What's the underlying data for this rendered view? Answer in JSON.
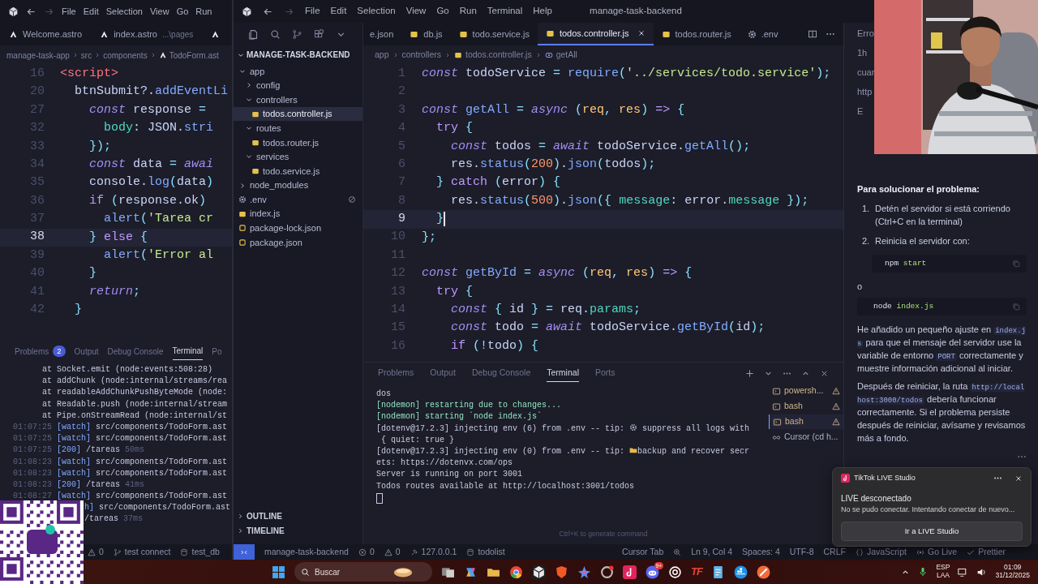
{
  "left_window": {
    "menu": [
      "File",
      "Edit",
      "Selection",
      "View",
      "Go",
      "Run"
    ],
    "tabs": [
      {
        "label": "Welcome.astro",
        "selected": false
      },
      {
        "label": "index.astro",
        "detail": "...\\pages",
        "selected": false
      }
    ],
    "breadcrumb": [
      "manage-task-app",
      "src",
      "components",
      "TodoForm.ast"
    ],
    "code": [
      {
        "n": "16",
        "current": false,
        "tokens": [
          {
            "text": "<script>",
            "kind": "tag"
          }
        ]
      },
      {
        "n": "20",
        "current": false,
        "tokens": [
          {
            "text": "  btnSubmit?.",
            "kind": "variable"
          },
          {
            "text": "addEventLi",
            "kind": "function"
          }
        ]
      },
      {
        "n": "27",
        "current": false,
        "tokens": [
          {
            "text": "    const ",
            "kind": "keyword"
          },
          {
            "text": "response ",
            "kind": "variable"
          },
          {
            "text": "=",
            "kind": "operator"
          }
        ]
      },
      {
        "n": "32",
        "current": false,
        "tokens": [
          {
            "text": "      body",
            "kind": "property"
          },
          {
            "text": ": JSON.",
            "kind": "variable"
          },
          {
            "text": "stri",
            "kind": "function"
          }
        ]
      },
      {
        "n": "33",
        "current": false,
        "tokens": [
          {
            "text": "    })",
            "kind": "punct"
          },
          {
            "text": ";",
            "kind": "operator"
          }
        ]
      },
      {
        "n": "34",
        "current": false,
        "tokens": [
          {
            "text": "    const ",
            "kind": "keyword"
          },
          {
            "text": "data ",
            "kind": "variable"
          },
          {
            "text": "= ",
            "kind": "operator"
          },
          {
            "text": "awai",
            "kind": "keyword"
          }
        ]
      },
      {
        "n": "35",
        "current": false,
        "tokens": [
          {
            "text": "    console.",
            "kind": "variable"
          },
          {
            "text": "log",
            "kind": "function"
          },
          {
            "text": "(",
            "kind": "punct"
          },
          {
            "text": "data",
            "kind": "variable"
          },
          {
            "text": ")",
            "kind": "punct"
          }
        ]
      },
      {
        "n": "36",
        "current": false,
        "tokens": [
          {
            "text": "    if ",
            "kind": "control"
          },
          {
            "text": "(",
            "kind": "punct"
          },
          {
            "text": "response.ok",
            "kind": "variable"
          },
          {
            "text": ")",
            "kind": "punct"
          }
        ]
      },
      {
        "n": "37",
        "current": false,
        "tokens": [
          {
            "text": "      alert",
            "kind": "function"
          },
          {
            "text": "(",
            "kind": "punct"
          },
          {
            "text": "'Tarea cr",
            "kind": "string"
          }
        ]
      },
      {
        "n": "38",
        "current": true,
        "tokens": [
          {
            "text": "    } ",
            "kind": "punct"
          },
          {
            "text": "else ",
            "kind": "control"
          },
          {
            "text": "{",
            "kind": "punct"
          }
        ]
      },
      {
        "n": "39",
        "current": false,
        "tokens": [
          {
            "text": "      alert",
            "kind": "function"
          },
          {
            "text": "(",
            "kind": "punct"
          },
          {
            "text": "'Error al",
            "kind": "string"
          }
        ]
      },
      {
        "n": "40",
        "current": false,
        "tokens": [
          {
            "text": "    }",
            "kind": "punct"
          }
        ]
      },
      {
        "n": "41",
        "current": false,
        "tokens": [
          {
            "text": "    return",
            "kind": "keyword"
          },
          {
            "text": ";",
            "kind": "operator"
          }
        ]
      },
      {
        "n": "42",
        "current": false,
        "tokens": [
          {
            "text": "  }",
            "kind": "punct"
          }
        ]
      }
    ],
    "panel_tabs": [
      {
        "label": "Problems",
        "badge": "2",
        "selected": false
      },
      {
        "label": "Output",
        "selected": false
      },
      {
        "label": "Debug Console",
        "selected": false
      },
      {
        "label": "Terminal",
        "selected": true
      },
      {
        "label": "Po",
        "selected": false
      }
    ],
    "terminal": [
      {
        "kind": "line",
        "text": "      at Socket.emit (node:events:508:28)"
      },
      {
        "kind": "line",
        "text": "      at addChunk (node:internal/streams/rea"
      },
      {
        "kind": "line",
        "text": "      at readableAddChunkPushByteMode (node:"
      },
      {
        "kind": "line",
        "text": "      at Readable.push (node:internal/stream"
      },
      {
        "kind": "line",
        "text": "      at Pipe.onStreamRead (node:internal/st"
      },
      {
        "kind": "line",
        "time": "01:07:25 ",
        "tag": "[watch]",
        "text": " src/components/TodoForm.ast"
      },
      {
        "kind": "line",
        "time": "01:07:25 ",
        "tag": "[watch]",
        "text": " src/components/TodoForm.ast"
      },
      {
        "kind": "line",
        "time": "01:07:25 ",
        "tag": "[200]",
        "text": " /tareas ",
        "ms": "50ms"
      },
      {
        "kind": "line",
        "time": "01:08:23 ",
        "tag": "[watch]",
        "text": " src/components/TodoForm.ast"
      },
      {
        "kind": "line",
        "time": "01:08:23 ",
        "tag": "[watch]",
        "text": " src/components/TodoForm.ast"
      },
      {
        "kind": "line",
        "time": "01:08:23 ",
        "tag": "[200]",
        "text": " /tareas ",
        "ms": "41ms"
      },
      {
        "kind": "line",
        "time": "01:08:27 ",
        "tag": "[watch]",
        "text": " src/components/TodoForm.ast"
      },
      {
        "kind": "clipped",
        "tag": "h]",
        "text": " src/components/TodoForm.ast"
      },
      {
        "kind": "clipped",
        "text": "/tareas ",
        "ms": "37ms"
      }
    ],
    "status": [
      {
        "kind": "warning",
        "text": "0"
      },
      {
        "kind": "branch",
        "text": "test connect"
      },
      {
        "kind": "db",
        "text": "test_db"
      }
    ]
  },
  "main_window": {
    "menu": [
      "File",
      "Edit",
      "Selection",
      "View",
      "Go",
      "Run",
      "Terminal",
      "Help"
    ],
    "title": "manage-task-backend",
    "explorer": {
      "title": "MANAGE-TASK-BACKEND",
      "tree": [
        {
          "label": "app",
          "kind": "folder",
          "expanded": true,
          "selected": false,
          "ignored": false,
          "children": [
            {
              "label": "config",
              "kind": "folder",
              "expanded": false,
              "selected": false
            },
            {
              "label": "controllers",
              "kind": "folder",
              "expanded": true,
              "selected": false,
              "children": [
                {
                  "label": "todos.controller.js",
                  "kind": "js",
                  "selected": true
                }
              ]
            },
            {
              "label": "routes",
              "kind": "folder",
              "expanded": true,
              "selected": false,
              "children": [
                {
                  "label": "todos.router.js",
                  "kind": "js",
                  "selected": false
                }
              ]
            },
            {
              "label": "services",
              "kind": "folder",
              "expanded": true,
              "selected": false,
              "children": [
                {
                  "label": "todo.service.js",
                  "kind": "js",
                  "selected": false
                }
              ]
            }
          ]
        },
        {
          "label": "node_modules",
          "kind": "folder",
          "expanded": false,
          "selected": false,
          "ignored": false
        },
        {
          "label": ".env",
          "kind": "env",
          "selected": false,
          "ignored": true
        },
        {
          "label": "index.js",
          "kind": "js",
          "selected": false,
          "ignored": false
        },
        {
          "label": "package-lock.json",
          "kind": "json",
          "selected": false,
          "ignored": false
        },
        {
          "label": "package.json",
          "kind": "json",
          "selected": false,
          "ignored": false
        }
      ],
      "outline": "OUTLINE",
      "timeline": "TIMELINE"
    },
    "tabs": [
      {
        "label": "e.json",
        "kind": "hidden",
        "selected": false
      },
      {
        "label": "db.js",
        "kind": "js",
        "selected": false
      },
      {
        "label": "todo.service.js",
        "kind": "js",
        "selected": false
      },
      {
        "label": "todos.controller.js",
        "kind": "js",
        "selected": true
      },
      {
        "label": "todos.router.js",
        "kind": "js",
        "selected": false
      },
      {
        "label": ".env",
        "kind": "env",
        "selected": false
      }
    ],
    "breadcrumb": [
      {
        "text": "app",
        "kind": "folder"
      },
      {
        "text": "controllers",
        "kind": "folder"
      },
      {
        "text": "todos.controller.js",
        "kind": "js"
      },
      {
        "text": "getAll",
        "kind": "symbol"
      }
    ],
    "code": [
      {
        "n": "1",
        "current": false,
        "tokens": [
          {
            "text": "const ",
            "kind": "keyword"
          },
          {
            "text": "todoService ",
            "kind": "variable"
          },
          {
            "text": "= ",
            "kind": "operator"
          },
          {
            "text": "require",
            "kind": "function"
          },
          {
            "text": "(",
            "kind": "punct"
          },
          {
            "text": "'../services/todo.service'",
            "kind": "string"
          },
          {
            "text": ")",
            "kind": "punct"
          },
          {
            "text": ";",
            "kind": "operator"
          }
        ]
      },
      {
        "n": "2",
        "current": false
      },
      {
        "n": "3",
        "current": false,
        "tokens": [
          {
            "text": "const ",
            "kind": "keyword"
          },
          {
            "text": "getAll ",
            "kind": "function"
          },
          {
            "text": "= ",
            "kind": "operator"
          },
          {
            "text": "async ",
            "kind": "keyword"
          },
          {
            "text": "(",
            "kind": "punct"
          },
          {
            "text": "req",
            "kind": "param"
          },
          {
            "text": ", ",
            "kind": "operator"
          },
          {
            "text": "res",
            "kind": "param"
          },
          {
            "text": ") ",
            "kind": "punct"
          },
          {
            "text": "=> ",
            "kind": "control"
          },
          {
            "text": "{",
            "kind": "punct"
          }
        ]
      },
      {
        "n": "4",
        "current": false,
        "tokens": [
          {
            "text": "  try ",
            "kind": "control"
          },
          {
            "text": "{",
            "kind": "punct"
          }
        ]
      },
      {
        "n": "5",
        "current": false,
        "tokens": [
          {
            "text": "    const ",
            "kind": "keyword"
          },
          {
            "text": "todos ",
            "kind": "variable"
          },
          {
            "text": "= ",
            "kind": "operator"
          },
          {
            "text": "await ",
            "kind": "keyword"
          },
          {
            "text": "todoService.",
            "kind": "variable"
          },
          {
            "text": "getAll",
            "kind": "function"
          },
          {
            "text": "()",
            "kind": "punct"
          },
          {
            "text": ";",
            "kind": "operator"
          }
        ]
      },
      {
        "n": "6",
        "current": false,
        "tokens": [
          {
            "text": "    res.",
            "kind": "variable"
          },
          {
            "text": "status",
            "kind": "function"
          },
          {
            "text": "(",
            "kind": "punct"
          },
          {
            "text": "200",
            "kind": "number"
          },
          {
            "text": ")",
            "kind": "punct"
          },
          {
            "text": ".",
            "kind": "variable"
          },
          {
            "text": "json",
            "kind": "function"
          },
          {
            "text": "(",
            "kind": "punct"
          },
          {
            "text": "todos",
            "kind": "variable"
          },
          {
            "text": ")",
            "kind": "punct"
          },
          {
            "text": ";",
            "kind": "operator"
          }
        ]
      },
      {
        "n": "7",
        "current": false,
        "tokens": [
          {
            "text": "  } ",
            "kind": "punct"
          },
          {
            "text": "catch ",
            "kind": "control"
          },
          {
            "text": "(",
            "kind": "punct"
          },
          {
            "text": "error",
            "kind": "variable"
          },
          {
            "text": ") {",
            "kind": "punct"
          }
        ]
      },
      {
        "n": "8",
        "current": false,
        "tokens": [
          {
            "text": "    res.",
            "kind": "variable"
          },
          {
            "text": "status",
            "kind": "function"
          },
          {
            "text": "(",
            "kind": "punct"
          },
          {
            "text": "500",
            "kind": "number"
          },
          {
            "text": ")",
            "kind": "punct"
          },
          {
            "text": ".",
            "kind": "variable"
          },
          {
            "text": "json",
            "kind": "function"
          },
          {
            "text": "({ ",
            "kind": "punct"
          },
          {
            "text": "message",
            "kind": "property"
          },
          {
            "text": ": error.",
            "kind": "variable"
          },
          {
            "text": "message",
            "kind": "property"
          },
          {
            "text": " })",
            "kind": "punct"
          },
          {
            "text": ";",
            "kind": "operator"
          }
        ]
      },
      {
        "n": "9",
        "current": true,
        "tokens": [
          {
            "text": "  }",
            "kind": "punct"
          }
        ]
      },
      {
        "n": "10",
        "current": false,
        "tokens": [
          {
            "text": "}",
            "kind": "punct"
          },
          {
            "text": ";",
            "kind": "operator"
          }
        ]
      },
      {
        "n": "11",
        "current": false
      },
      {
        "n": "12",
        "current": false,
        "tokens": [
          {
            "text": "const ",
            "kind": "keyword"
          },
          {
            "text": "getById ",
            "kind": "function"
          },
          {
            "text": "= ",
            "kind": "operator"
          },
          {
            "text": "async ",
            "kind": "keyword"
          },
          {
            "text": "(",
            "kind": "punct"
          },
          {
            "text": "req",
            "kind": "param"
          },
          {
            "text": ", ",
            "kind": "operator"
          },
          {
            "text": "res",
            "kind": "param"
          },
          {
            "text": ") ",
            "kind": "punct"
          },
          {
            "text": "=> ",
            "kind": "control"
          },
          {
            "text": "{",
            "kind": "punct"
          }
        ]
      },
      {
        "n": "13",
        "current": false,
        "tokens": [
          {
            "text": "  try ",
            "kind": "control"
          },
          {
            "text": "{",
            "kind": "punct"
          }
        ]
      },
      {
        "n": "14",
        "current": false,
        "tokens": [
          {
            "text": "    const ",
            "kind": "keyword"
          },
          {
            "text": "{ ",
            "kind": "punct"
          },
          {
            "text": "id ",
            "kind": "variable"
          },
          {
            "text": "} ",
            "kind": "punct"
          },
          {
            "text": "= ",
            "kind": "operator"
          },
          {
            "text": "req.",
            "kind": "variable"
          },
          {
            "text": "params",
            "kind": "property"
          },
          {
            "text": ";",
            "kind": "operator"
          }
        ]
      },
      {
        "n": "15",
        "current": false,
        "tokens": [
          {
            "text": "    const ",
            "kind": "keyword"
          },
          {
            "text": "todo ",
            "kind": "variable"
          },
          {
            "text": "= ",
            "kind": "operator"
          },
          {
            "text": "await ",
            "kind": "keyword"
          },
          {
            "text": "todoService.",
            "kind": "variable"
          },
          {
            "text": "getById",
            "kind": "function"
          },
          {
            "text": "(",
            "kind": "punct"
          },
          {
            "text": "id",
            "kind": "variable"
          },
          {
            "text": ")",
            "kind": "punct"
          },
          {
            "text": ";",
            "kind": "operator"
          }
        ]
      },
      {
        "n": "16",
        "current": false,
        "tokens": [
          {
            "text": "    if ",
            "kind": "control"
          },
          {
            "text": "(",
            "kind": "punct"
          },
          {
            "text": "!",
            "kind": "operator"
          },
          {
            "text": "todo",
            "kind": "variable"
          },
          {
            "text": ") {",
            "kind": "punct"
          }
        ]
      }
    ],
    "panel_tabs": [
      {
        "label": "Problems",
        "selected": false
      },
      {
        "label": "Output",
        "selected": false
      },
      {
        "label": "Debug Console",
        "selected": false
      },
      {
        "label": "Terminal",
        "selected": true
      },
      {
        "label": "Ports",
        "selected": false
      }
    ],
    "terminal": [
      {
        "kind": "output",
        "text": "dos"
      },
      {
        "kind": "nodemon",
        "text": "[nodemon] restarting due to changes..."
      },
      {
        "kind": "nodemon",
        "text": "[nodemon] starting `node index.js`"
      },
      {
        "kind": "gear-tip",
        "text": "[dotenv@17.2.3] injecting env (6) from .env -- tip: ",
        "rest": "suppress all logs with"
      },
      {
        "kind": "output",
        "text": " { quiet: true }"
      },
      {
        "kind": "folder-tip",
        "text": "[dotenv@17.2.3] injecting env (0) from .env -- tip: ",
        "rest": "backup and recover secr"
      },
      {
        "kind": "output",
        "text": "ets: https://dotenvx.com/ops"
      },
      {
        "kind": "output",
        "text": "Server is running on port 3001"
      },
      {
        "kind": "output",
        "text": "Todos routes available at http://localhost:3001/todos"
      }
    ],
    "terminals": [
      {
        "label": "powersh...",
        "kind": "shell",
        "warning": true,
        "selected": false
      },
      {
        "label": "bash",
        "kind": "shell",
        "warning": true,
        "selected": false
      },
      {
        "label": "bash",
        "kind": "shell",
        "warning": true,
        "selected": true
      },
      {
        "label": "Cursor (cd h...",
        "kind": "agent",
        "warning": false,
        "selected": false
      }
    ],
    "hint": "Ctrl+K to generate command",
    "status_left": [
      {
        "kind": "remote"
      },
      {
        "kind": "plain",
        "text": "manage-task-backend"
      },
      {
        "kind": "error",
        "text": "0"
      },
      {
        "kind": "warning",
        "text": "0"
      },
      {
        "kind": "plug",
        "text": "127.0.0.1"
      },
      {
        "kind": "db",
        "text": "todolist"
      }
    ],
    "status_right": [
      {
        "kind": "plain",
        "text": "Cursor Tab"
      },
      {
        "kind": "zoom"
      },
      {
        "kind": "plain",
        "text": "Ln 9, Col 4"
      },
      {
        "kind": "plain",
        "text": "Spaces: 4"
      },
      {
        "kind": "plain",
        "text": "UTF-8"
      },
      {
        "kind": "plain",
        "text": "CRLF"
      },
      {
        "kind": "braces",
        "text": "JavaScript"
      },
      {
        "kind": "radio",
        "text": "Go Live"
      },
      {
        "kind": "check",
        "text": "Prettier"
      }
    ]
  },
  "chat": {
    "fragments": [
      "Erro",
      "1h",
      "cuar",
      "http",
      "E"
    ],
    "blocks": [
      {
        "kind": "heading",
        "text": "Para solucionar el problema:"
      },
      {
        "kind": "steps",
        "items": [
          {
            "marker": "1.",
            "text": "Detén el servidor si está corriendo (Ctrl+C en la terminal)"
          },
          {
            "marker": "2.",
            "text": "Reinicia el servidor con:"
          }
        ]
      },
      {
        "kind": "code",
        "nested": true,
        "tokens": [
          {
            "text": "npm ",
            "kind": "command"
          },
          {
            "text": "start",
            "kind": "argument"
          }
        ]
      },
      {
        "kind": "text",
        "text": "o"
      },
      {
        "kind": "code",
        "nested": false,
        "tokens": [
          {
            "text": "node ",
            "kind": "command"
          },
          {
            "text": "index.js",
            "kind": "argument"
          }
        ]
      },
      {
        "kind": "para",
        "parts": [
          {
            "text": "He añadido un pequeño ajuste en "
          },
          {
            "code": "index.js"
          },
          {
            "text": " para que el mensaje del servidor use la variable de entorno "
          },
          {
            "code": "PORT"
          },
          {
            "text": " correctamente y muestre información adicional al iniciar."
          }
        ]
      },
      {
        "kind": "para",
        "parts": [
          {
            "text": "Después de reiniciar, la ruta "
          },
          {
            "code": "http://localhost:3000/todos"
          },
          {
            "text": " debería funcionar correctamente. Si el problema persiste después de reiniciar, avísame y revisamos más a fondo."
          }
        ]
      }
    ]
  },
  "notification": {
    "app": "TikTok LIVE Studio",
    "title": "LIVE desconectado",
    "body": "No se pudo conectar. Intentando conectar de nuevo...",
    "button": "Ir a LIVE Studio"
  },
  "taskbar": {
    "search": {
      "placeholder": "Buscar"
    },
    "badge": "9+",
    "logo_text": "TF",
    "tray": {
      "lang": "ESP",
      "region": "LAA",
      "time": "01:09",
      "date": "31/12/2025"
    }
  }
}
